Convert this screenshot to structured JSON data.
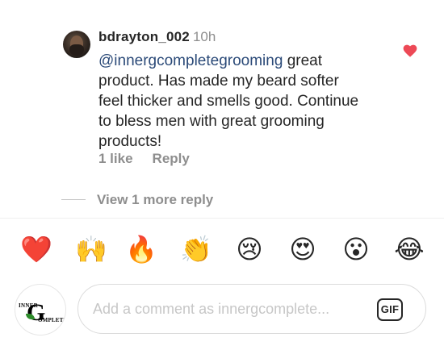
{
  "comment": {
    "username": "bdrayton_002",
    "time": "10h",
    "mention": "@innergcompletegrooming",
    "text": " great product.  Has made my beard softer feel thicker and smells good.  Continue to bless men with great grooming products!",
    "likes": "1 like",
    "reply_label": "Reply",
    "view_more": "View 1 more reply",
    "liked_icon": "heart-filled-icon",
    "accent_color": "#ed4956"
  },
  "emoji_bar": {
    "items": [
      "❤️",
      "🙌",
      "🔥",
      "👏",
      "😢",
      "😍",
      "😮",
      "😂"
    ]
  },
  "composer": {
    "avatar_text_top": "INNER",
    "avatar_letter": "G",
    "avatar_text_bottom": "OMPLETE",
    "placeholder": "Add a comment as innergcomplete...",
    "gif_label": "GIF"
  }
}
